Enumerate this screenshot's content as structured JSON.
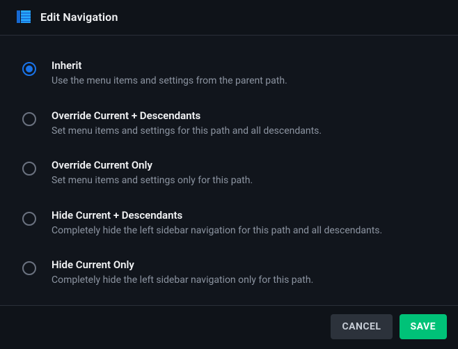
{
  "header": {
    "title": "Edit Navigation"
  },
  "options": [
    {
      "label": "Inherit",
      "description": "Use the menu items and settings from the parent path.",
      "selected": true
    },
    {
      "label": "Override Current + Descendants",
      "description": "Set menu items and settings for this path and all descendants.",
      "selected": false
    },
    {
      "label": "Override Current Only",
      "description": "Set menu items and settings only for this path.",
      "selected": false
    },
    {
      "label": "Hide Current + Descendants",
      "description": "Completely hide the left sidebar navigation for this path and all descendants.",
      "selected": false
    },
    {
      "label": "Hide Current Only",
      "description": "Completely hide the left sidebar navigation only for this path.",
      "selected": false
    }
  ],
  "footer": {
    "cancel": "CANCEL",
    "save": "SAVE"
  }
}
